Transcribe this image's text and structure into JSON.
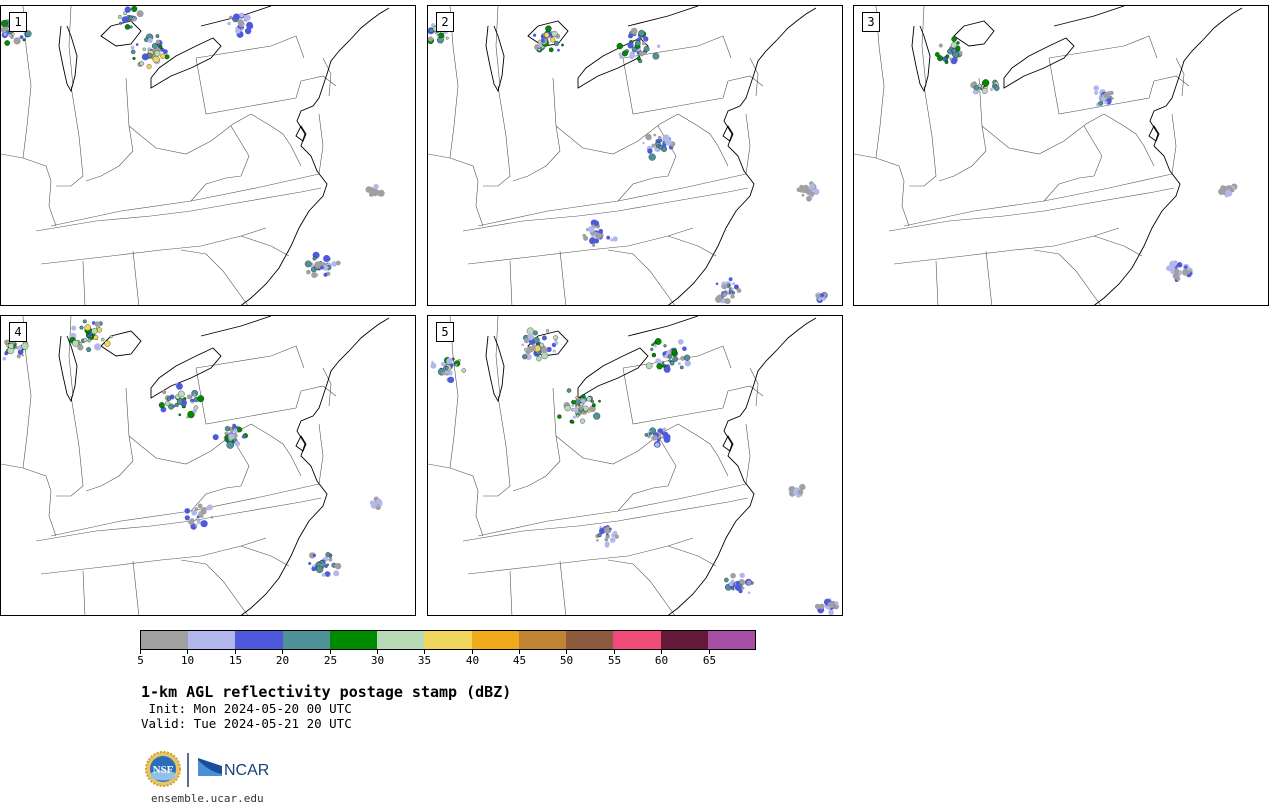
{
  "panels": [
    {
      "label": "1"
    },
    {
      "label": "2"
    },
    {
      "label": "3"
    },
    {
      "label": "4"
    },
    {
      "label": "5"
    }
  ],
  "colorbar": {
    "colors": [
      "#a0a0a0",
      "#b3b8ec",
      "#4f59dc",
      "#4f9399",
      "#008a00",
      "#b7dbb9",
      "#f0d65a",
      "#f0aa1c",
      "#c08435",
      "#8c5a3c",
      "#f04b78",
      "#641938",
      "#a550a5"
    ],
    "ticks": [
      "5",
      "10",
      "15",
      "20",
      "25",
      "30",
      "35",
      "40",
      "45",
      "50",
      "55",
      "60",
      "65"
    ]
  },
  "texts": {
    "title": "1-km AGL reflectivity postage stamp (dBZ)",
    "init": " Init: Mon 2024-05-20 00 UTC",
    "valid": "Valid: Tue 2024-05-21 20 UTC",
    "footer_url": "ensemble.ucar.edu",
    "logo_nsf": "NSF",
    "logo_ncar": "NCAR"
  },
  "icons": {
    "nsf_logo": "nsf-logo-icon",
    "ncar_logo": "ncar-logo-icon"
  }
}
